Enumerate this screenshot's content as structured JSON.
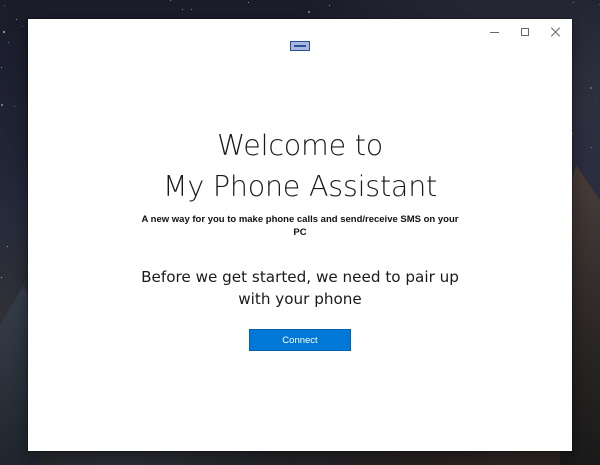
{
  "window": {
    "title_icon": "app-window-icon",
    "controls": {
      "minimize_icon": "minimize-icon",
      "maximize_icon": "maximize-icon",
      "close_icon": "close-icon"
    }
  },
  "main": {
    "title_line1": "Welcome to",
    "title_line2": "My Phone Assistant",
    "subtitle": "A new way for you to make phone calls and send/receive SMS on your PC",
    "pair_text": "Before we get started, we need to pair up with your phone",
    "connect_label": "Connect"
  },
  "colors": {
    "accent": "#0078d7",
    "window_bg": "#ffffff",
    "text": "#1a1a1a"
  }
}
